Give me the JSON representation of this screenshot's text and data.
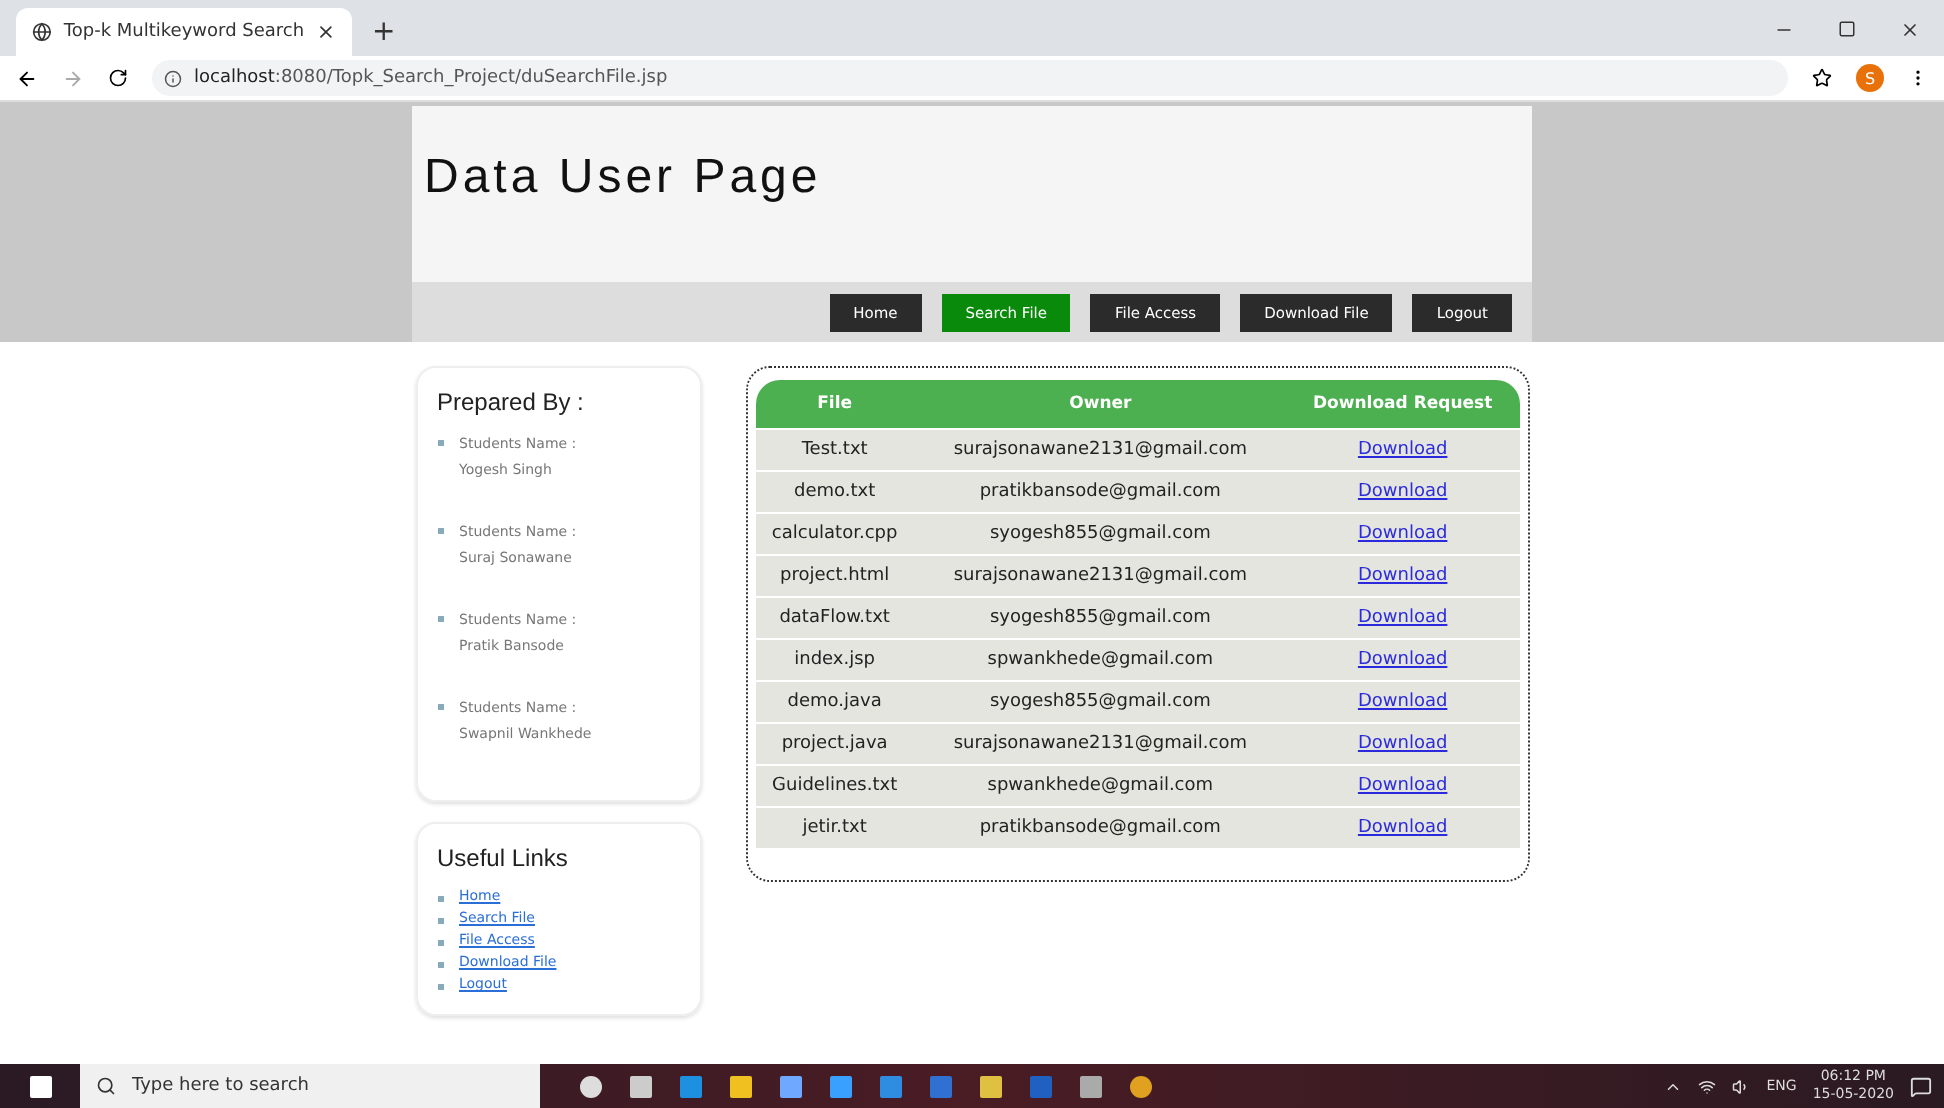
{
  "browser": {
    "tab_title": "Top-k Multikeyword Search",
    "new_tab": "+",
    "url_host": "localhost",
    "url_path": ":8080/Topk_Search_Project/duSearchFile.jsp",
    "profile_initial": "S"
  },
  "header": {
    "title": "Data User Page"
  },
  "nav": [
    {
      "label": "Home",
      "selected": false
    },
    {
      "label": "Search File",
      "selected": true
    },
    {
      "label": "File Access",
      "selected": false
    },
    {
      "label": "Download File",
      "selected": false
    },
    {
      "label": "Logout",
      "selected": false
    }
  ],
  "prepared_by": {
    "title": "Prepared By :",
    "students": [
      {
        "label": "Students Name :",
        "name": "Yogesh Singh"
      },
      {
        "label": "Students Name :",
        "name": "Suraj Sonawane"
      },
      {
        "label": "Students Name :",
        "name": "Pratik Bansode"
      },
      {
        "label": "Students Name :",
        "name": "Swapnil Wankhede"
      }
    ]
  },
  "useful_links": {
    "title": "Useful Links",
    "links": [
      "Home",
      "Search File",
      "File Access",
      "Download File",
      "Logout"
    ]
  },
  "table": {
    "columns": [
      "File",
      "Owner",
      "Download Request"
    ],
    "rows": [
      [
        "Test.txt",
        "surajsonawane2131@gmail.com",
        "Download"
      ],
      [
        "demo.txt",
        "pratikbansode@gmail.com",
        "Download"
      ],
      [
        "calculator.cpp",
        "syogesh855@gmail.com",
        "Download"
      ],
      [
        "project.html",
        "surajsonawane2131@gmail.com",
        "Download"
      ],
      [
        "dataFlow.txt",
        "syogesh855@gmail.com",
        "Download"
      ],
      [
        "index.jsp",
        "spwankhede@gmail.com",
        "Download"
      ],
      [
        "demo.java",
        "syogesh855@gmail.com",
        "Download"
      ],
      [
        "project.java",
        "surajsonawane2131@gmail.com",
        "Download"
      ],
      [
        "Guidelines.txt",
        "spwankhede@gmail.com",
        "Download"
      ],
      [
        "jetir.txt",
        "pratikbansode@gmail.com",
        "Download"
      ]
    ]
  },
  "taskbar": {
    "search_placeholder": "Type here to search",
    "language": "ENG",
    "time": "06:12 PM",
    "date": "15-05-2020"
  }
}
